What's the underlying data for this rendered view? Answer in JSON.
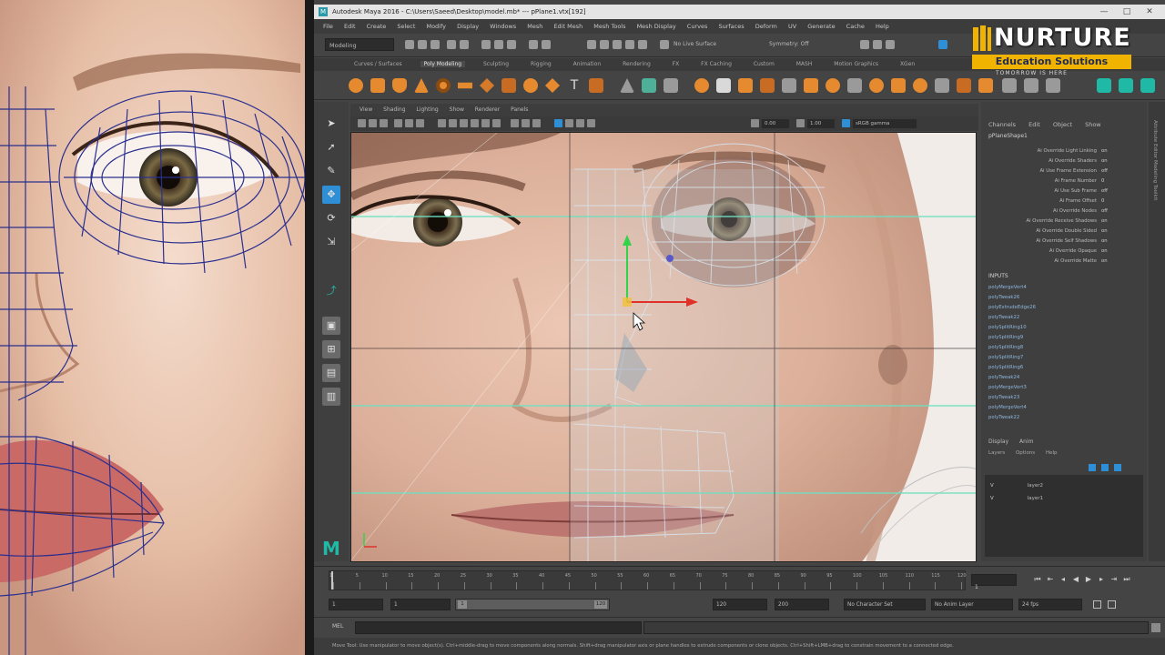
{
  "window": {
    "title": "Autodesk Maya 2016 - C:\\Users\\Saeed\\Desktop\\model.mb* --- pPlane1.vtx[192]",
    "controls": [
      "—",
      "□",
      "✕"
    ]
  },
  "menubar": [
    "File",
    "Edit",
    "Create",
    "Select",
    "Modify",
    "Display",
    "Windows",
    "Mesh",
    "Edit Mesh",
    "Mesh Tools",
    "Mesh Display",
    "Curves",
    "Surfaces",
    "Deform",
    "UV",
    "Generate",
    "Cache",
    "Help"
  ],
  "statusline": {
    "mode": "Modeling",
    "live_surface": "No Live Surface",
    "symmetry": "Symmetry: Off"
  },
  "shelf_tabs": [
    "Curves / Surfaces",
    "Poly Modeling",
    "Sculpting",
    "Rigging",
    "Animation",
    "Rendering",
    "FX",
    "FX Caching",
    "Custom",
    "MASH",
    "Motion Graphics",
    "XGen"
  ],
  "shelf_active_tab": "Poly Modeling",
  "panel_menu": [
    "View",
    "Shading",
    "Lighting",
    "Show",
    "Renderer",
    "Panels"
  ],
  "panel_toolbar": {
    "near": "0.00",
    "far": "1.00",
    "color_space": "sRGB gamma"
  },
  "channel_box": {
    "tabs": [
      "Channels",
      "Edit",
      "Object",
      "Show"
    ],
    "object": "pPlaneShape1",
    "attributes": [
      {
        "name": "Ai Override Light Linking",
        "value": "on"
      },
      {
        "name": "Ai Override Shaders",
        "value": "on"
      },
      {
        "name": "Ai Use Frame Extension",
        "value": "off"
      },
      {
        "name": "Ai Frame Number",
        "value": "0"
      },
      {
        "name": "Ai Use Sub Frame",
        "value": "off"
      },
      {
        "name": "Ai Frame Offset",
        "value": "0"
      },
      {
        "name": "Ai Override Nodes",
        "value": "off"
      },
      {
        "name": "Ai Override Receive Shadows",
        "value": "on"
      },
      {
        "name": "Ai Override Double Sided",
        "value": "on"
      },
      {
        "name": "Ai Override Self Shadows",
        "value": "on"
      },
      {
        "name": "Ai Override Opaque",
        "value": "on"
      },
      {
        "name": "Ai Override Matte",
        "value": "on"
      }
    ],
    "inputs_title": "INPUTS",
    "inputs": [
      "polyMergeVert4",
      "polyTweak26",
      "polyExtrudeEdge26",
      "polyTweak22",
      "polySplitRing10",
      "polySplitRing9",
      "polySplitRing8",
      "polySplitRing7",
      "polySplitRing6",
      "polyTweak24",
      "polyMergeVert3",
      "polyTweak23",
      "polyMergeVert4",
      "polyTweak22"
    ],
    "layer_tabs": [
      "Display",
      "Anim"
    ],
    "layer_menu": [
      "Layers",
      "Options",
      "Help"
    ],
    "layers": [
      {
        "v": "V",
        "name": "layer2"
      },
      {
        "v": "V",
        "name": "layer1"
      }
    ],
    "side_label": "Attribute Editor   Modeling Toolkit"
  },
  "timeline": {
    "ticks": [
      "1",
      "5",
      "10",
      "15",
      "20",
      "25",
      "30",
      "35",
      "40",
      "45",
      "50",
      "55",
      "60",
      "65",
      "70",
      "75",
      "80",
      "85",
      "90",
      "95",
      "100",
      "105",
      "110",
      "115",
      "120"
    ],
    "current_frame": "1"
  },
  "range": {
    "start": "1",
    "inner_start": "1",
    "slider_start": "1",
    "slider_end": "120",
    "inner_end": "120",
    "end": "200",
    "character_set": "No Character Set",
    "anim_layer": "No Anim Layer",
    "fps": "24 fps"
  },
  "command_line": {
    "label": "MEL"
  },
  "helpline": "Move Tool: Use manipulator to move object(s). Ctrl+middle-drag to move components along normals. Shift+drag manipulator axis or plane handles to extrude components or clone objects. Ctrl+Shift+LMB+drag to constrain movement to a connected edge.",
  "logo": {
    "word": "NURTURE",
    "tagline_bar": "Education Solutions",
    "tag": "TOMORROW IS HERE",
    "colors": {
      "gold": "#f0b400",
      "navy": "#1f2a5a"
    }
  },
  "colors": {
    "maya_teal": "#1fb9a6",
    "wire_blue": "#2a2f8f",
    "guide_cyan": "#6fe0c0"
  }
}
